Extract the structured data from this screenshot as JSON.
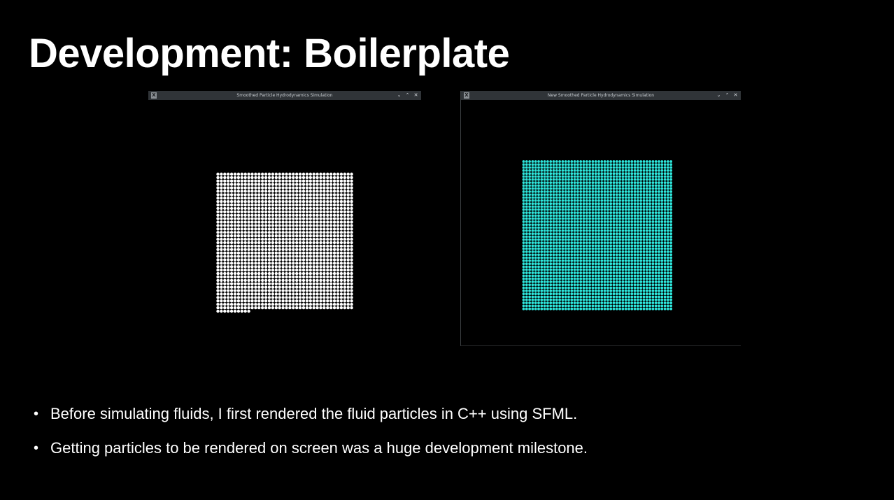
{
  "slide": {
    "title": "Development: Boilerplate",
    "bullets": [
      "Before simulating fluids, I first rendered the fluid particles in C++ using SFML.",
      "Getting particles to be rendered on screen was a huge development milestone."
    ]
  },
  "windows": [
    {
      "title": "Smoothed Particle Hydrodynamics Simulation",
      "app_icon": "x11-app-icon",
      "controls": [
        "minimize-icon",
        "maximize-icon",
        "close-icon"
      ],
      "particle_color": "#ffffff",
      "background": "#000000"
    },
    {
      "title": "New Smoothed Particle Hydrodynamics Simulation",
      "app_icon": "x11-app-icon",
      "controls": [
        "minimize-icon",
        "maximize-icon",
        "close-icon"
      ],
      "particle_color": "#2ee6dc",
      "background": "#000000"
    }
  ],
  "glyphs": {
    "app_icon": "X",
    "minimize": "⌄",
    "maximize": "⌃",
    "close": "✕",
    "bullet": "•"
  },
  "colors": {
    "slide_background": "#000000",
    "text": "#ffffff",
    "titlebar": "#303438"
  }
}
